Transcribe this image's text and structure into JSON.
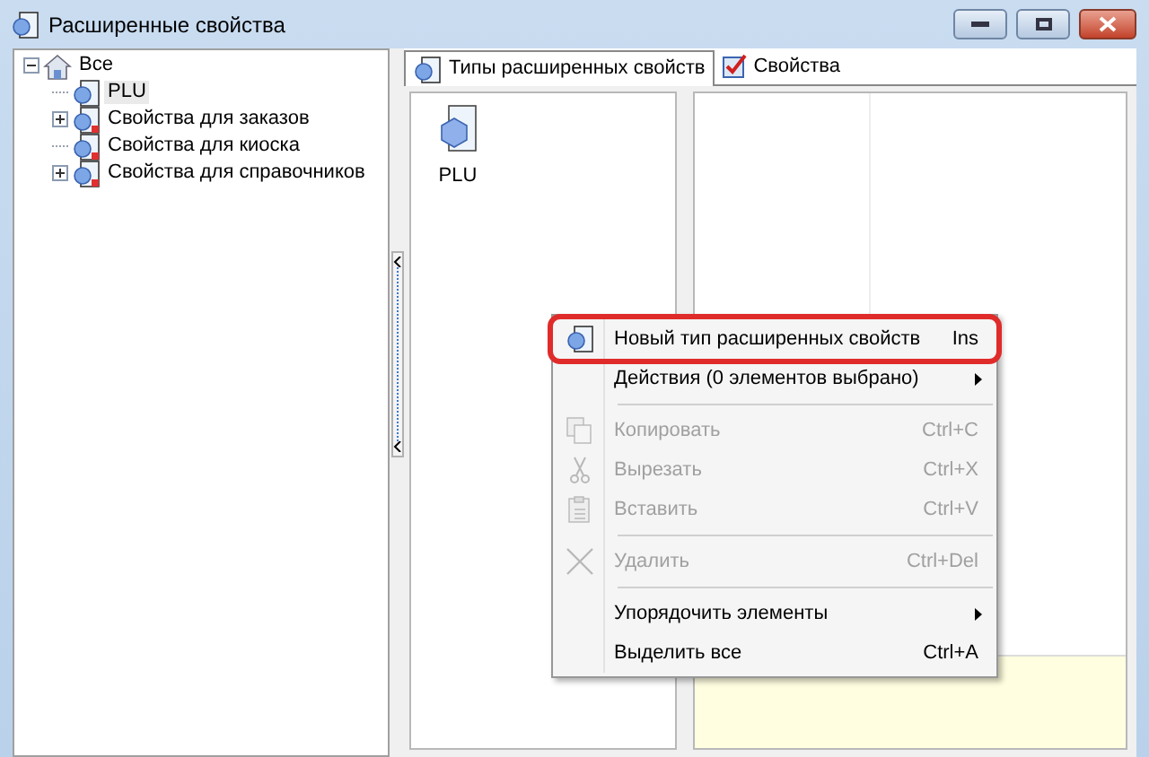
{
  "window": {
    "title": "Расширенные свойства"
  },
  "tree": [
    {
      "label": "Все",
      "kind": "root",
      "expanded": true,
      "selected": false,
      "children": [
        {
          "label": "PLU",
          "kind": "type",
          "selected": true
        },
        {
          "label": "Свойства для заказов",
          "kind": "group",
          "expanded": false,
          "selected": false
        },
        {
          "label": "Свойства для киоска",
          "kind": "group",
          "selected": false
        },
        {
          "label": "Свойства для справочников",
          "kind": "group",
          "expanded": false,
          "selected": false
        }
      ]
    }
  ],
  "tabs": [
    {
      "label": "Типы расширенных свойств",
      "kind": "types",
      "selected": true
    },
    {
      "label": "Свойства",
      "kind": "properties",
      "selected": false
    }
  ],
  "list_items": [
    {
      "label": "PLU"
    }
  ],
  "context_menu": [
    {
      "kind": "new",
      "label": "Новый тип расширенных свойств",
      "shortcut": "Ins",
      "disabled": false,
      "highlighted": true,
      "submenu": false
    },
    {
      "kind": "plain",
      "label": "Действия (0 элементов выбрано)",
      "disabled": false,
      "highlighted": false,
      "submenu": true
    },
    {
      "kind": "separator"
    },
    {
      "kind": "copy",
      "label": "Копировать",
      "shortcut": "Ctrl+C",
      "disabled": true,
      "highlighted": false,
      "submenu": false
    },
    {
      "kind": "cut",
      "label": "Вырезать",
      "shortcut": "Ctrl+X",
      "disabled": true,
      "highlighted": false,
      "submenu": false
    },
    {
      "kind": "paste",
      "label": "Вставить",
      "shortcut": "Ctrl+V",
      "disabled": true,
      "highlighted": false,
      "submenu": false
    },
    {
      "kind": "separator"
    },
    {
      "kind": "delete",
      "label": "Удалить",
      "shortcut": "Ctrl+Del",
      "disabled": true,
      "highlighted": false,
      "submenu": false
    },
    {
      "kind": "separator"
    },
    {
      "kind": "plain",
      "label": "Упорядочить элементы",
      "disabled": false,
      "highlighted": false,
      "submenu": true
    },
    {
      "kind": "plain",
      "label": "Выделить все",
      "shortcut": "Ctrl+A",
      "disabled": false,
      "highlighted": false,
      "submenu": false
    }
  ]
}
